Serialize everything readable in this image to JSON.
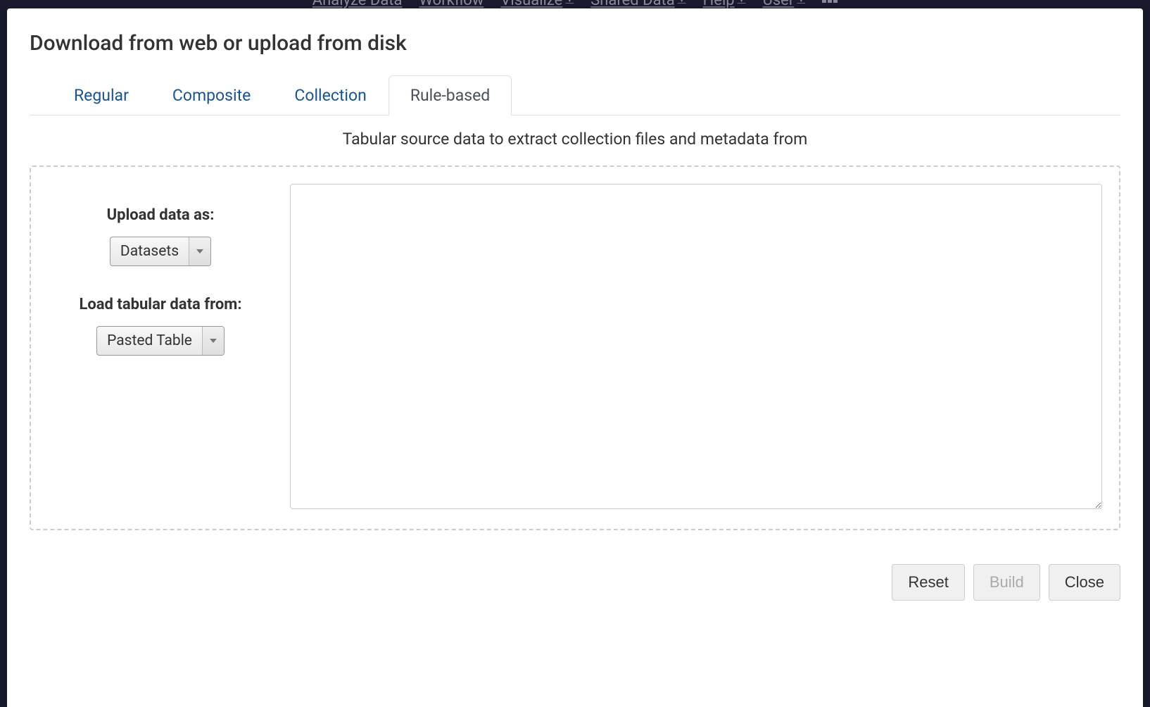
{
  "topnav": {
    "items": [
      {
        "label": "Analyze Data",
        "has_caret": false
      },
      {
        "label": "Workflow",
        "has_caret": false
      },
      {
        "label": "Visualize",
        "has_caret": true
      },
      {
        "label": "Shared Data",
        "has_caret": true
      },
      {
        "label": "Help",
        "has_caret": true
      },
      {
        "label": "User",
        "has_caret": true
      }
    ]
  },
  "modal": {
    "title": "Download from web or upload from disk",
    "tabs": [
      {
        "label": "Regular",
        "active": false
      },
      {
        "label": "Composite",
        "active": false
      },
      {
        "label": "Collection",
        "active": false
      },
      {
        "label": "Rule-based",
        "active": true
      }
    ],
    "description": "Tabular source data to extract collection files and metadata from",
    "controls": {
      "upload_as_label": "Upload data as:",
      "upload_as_value": "Datasets",
      "load_from_label": "Load tabular data from:",
      "load_from_value": "Pasted Table"
    },
    "textarea_value": "",
    "footer": {
      "reset": "Reset",
      "build": "Build",
      "close": "Close"
    }
  }
}
